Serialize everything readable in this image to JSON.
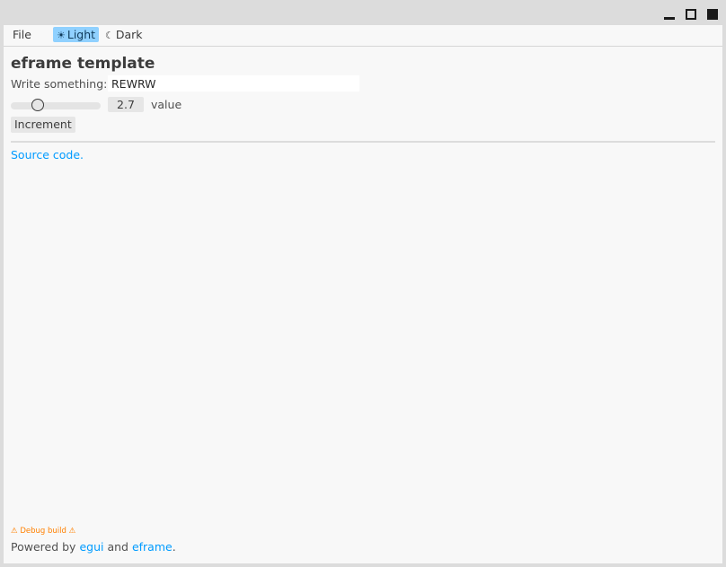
{
  "window": {
    "controls": [
      {
        "name": "minimize-icon"
      },
      {
        "name": "maximize-icon"
      },
      {
        "name": "close-icon"
      }
    ]
  },
  "menubar": {
    "file_label": "File",
    "theme": {
      "light_icon": "☀",
      "light_label": "Light",
      "dark_icon": "☾",
      "dark_label": "Dark",
      "selected": "Light"
    }
  },
  "main": {
    "title": "eframe template",
    "input_label": "Write something:",
    "input_value": "REWRW",
    "slider": {
      "value": "2.7",
      "min": 0,
      "max": 10,
      "label": "value"
    },
    "increment_label": "Increment",
    "source_link": "Source code."
  },
  "footer": {
    "debug_warning": "⚠ Debug build ⚠",
    "powered_prefix": "Powered by ",
    "egui_link": "egui",
    "and_text": " and ",
    "eframe_link": "eframe",
    "suffix": "."
  },
  "colors": {
    "accent": "#90d1ff",
    "link": "#009bff",
    "warning": "#ff8000",
    "panel_bg": "#f8f8f8"
  }
}
